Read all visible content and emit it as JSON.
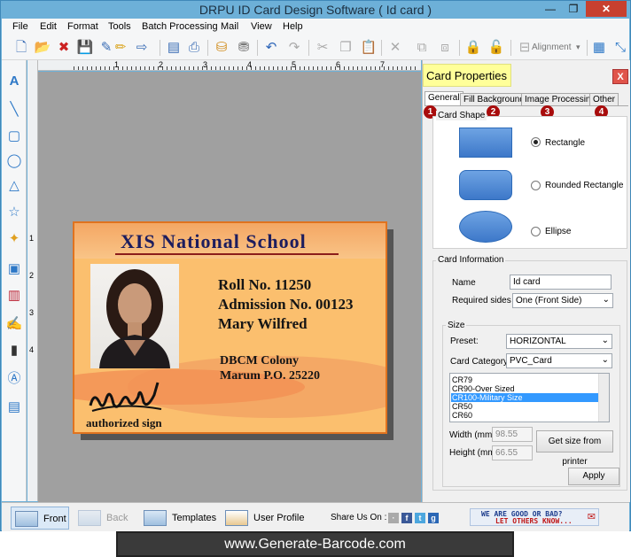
{
  "window": {
    "title": "DRPU ID Card Design Software ( Id card )",
    "min_glyph": "—",
    "max_glyph": "❐",
    "close_glyph": "✕"
  },
  "menu": [
    "File",
    "Edit",
    "Format",
    "Tools",
    "Batch Processing",
    "Mail",
    "View",
    "Help"
  ],
  "toolbar": {
    "alignment_label": "Alignment"
  },
  "rulers": {
    "h_numbers": [
      "1",
      "2",
      "3",
      "4",
      "5",
      "6",
      "7"
    ],
    "v_numbers": [
      "1",
      "2",
      "3",
      "4"
    ]
  },
  "card": {
    "school_name": "XIS National School",
    "roll": "Roll No. 11250",
    "admission": "Admission No. 00123",
    "name": "Mary Wilfred",
    "address_line1": "DBCM Colony",
    "address_line2": "Marum P.O. 25220",
    "signature_caption": "authorized sign"
  },
  "properties": {
    "title": "Card Properties",
    "close_glyph": "X",
    "tabs": [
      "General",
      "Fill Background",
      "Image Processing",
      "Other"
    ],
    "active_tab": "General",
    "badges": [
      "1",
      "2",
      "3",
      "4"
    ],
    "card_shape": {
      "label": "Card Shape",
      "options": [
        "Rectangle",
        "Rounded Rectangle",
        "Ellipse"
      ],
      "selected": "Rectangle"
    },
    "card_information": {
      "label": "Card Information",
      "name_label": "Name",
      "name_value": "Id card",
      "required_sides_label": "Required sides",
      "required_sides_value": "One (Front Side)"
    },
    "size": {
      "label": "Size",
      "preset_label": "Preset:",
      "preset_value": "HORIZONTAL",
      "category_label": "Card Category",
      "category_value": "PVC_Card",
      "list_items": [
        "CR79",
        "CR90-Over Sized",
        "CR100-Military Size",
        "CR50",
        "CR60"
      ],
      "selected_item": "CR100-Military Size",
      "width_label": "Width  (mm)",
      "width_value": "98.55",
      "height_label": "Height  (mm)",
      "height_value": "66.55",
      "get_size_button": "Get size from printer"
    },
    "apply_button": "Apply"
  },
  "bottom": {
    "front": "Front",
    "back": "Back",
    "templates": "Templates",
    "user_profile": "User Profile",
    "share": "Share Us On :",
    "feedback_line1": "WE ARE GOOD OR BAD?",
    "feedback_line2": "LET OTHERS KNOW..."
  },
  "banner": "www.Generate-Barcode.com"
}
